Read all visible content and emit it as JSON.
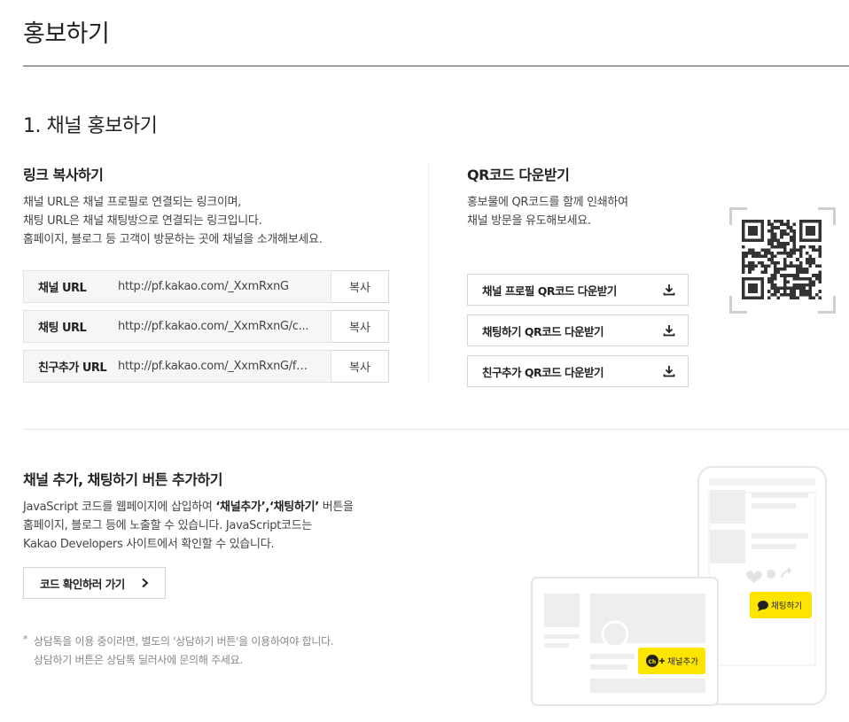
{
  "page_title": "홍보하기",
  "section": {
    "title": "1. 채널 홍보하기",
    "link": {
      "title": "링크 복사하기",
      "desc": [
        "채널 URL은 채널 프로필로 연결되는 링크이며,",
        "채팅 URL은 채널 채팅방으로 연결되는 링크입니다.",
        "홈페이지, 블로그 등 고객이 방문하는 곳에 채널을 소개해보세요."
      ],
      "rows": [
        {
          "label": "채널 URL",
          "value": "http://pf.kakao.com/_XxmRxnG",
          "button": "복사"
        },
        {
          "label": "채팅 URL",
          "value": "http://pf.kakao.com/_XxmRxnG/c...",
          "button": "복사"
        },
        {
          "label": "친구추가 URL",
          "value": "http://pf.kakao.com/_XxmRxnG/fri...",
          "button": "복사"
        }
      ]
    },
    "qr": {
      "title": "QR코드 다운받기",
      "desc": [
        "홍보물에 QR코드를 함께 인쇄하여",
        "채널 방문을 유도해보세요."
      ],
      "buttons": [
        "채널 프로필 QR코드 다운받기",
        "채팅하기 QR코드 다운받기",
        "친구추가 QR코드 다운받기"
      ]
    }
  },
  "buttons_section": {
    "title": "채널 추가, 채팅하기 버튼 추가하기",
    "desc_line1_pre": "JavaScript 코드를 웹페이지에 삽입하여 ",
    "desc_line1_bold": "‘채널추가’,‘채팅하기’",
    "desc_line1_post": " 버튼을",
    "desc_line2": "홈페이지, 블로그 등에 노출할 수 있습니다. JavaScript코드는",
    "desc_line3": "Kakao Developers 사이트에서 확인할 수 있습니다.",
    "go_button": "코드 확인하러 가기",
    "note_bullet": "*",
    "note": [
      "상담톡을 이용 중이라면, 별도의 '상담하기 버튼'을 이용하여야 합니다.",
      "상담하기 버튼은 상담톡 딜러사에 문의해 주세요."
    ],
    "illust": {
      "chat_badge": "채팅하기",
      "add_badge": "채널추가",
      "ch_logo": "Ch"
    }
  },
  "colors": {
    "accent": "#FEE500",
    "border": "#D6D6D6",
    "field_bg": "#F6F6F6"
  }
}
